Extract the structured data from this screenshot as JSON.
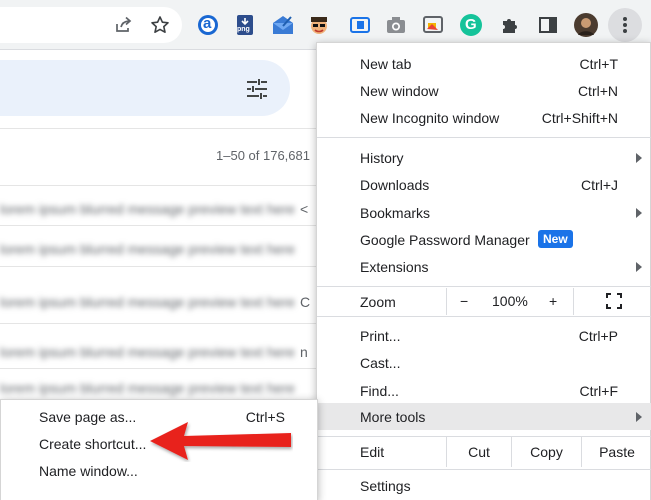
{
  "toolbar": {
    "icons": [
      "share-icon",
      "star-icon",
      "extension-a-icon",
      "extension-png-icon",
      "extension-mail-icon",
      "extension-avatar-icon",
      "extension-sidebar-icon",
      "camera-icon",
      "extension-image-icon",
      "grammarly-icon",
      "puzzle-icon",
      "side-panel-icon",
      "profile-avatar",
      "kebab-menu-icon"
    ],
    "grammarly_letter": "G",
    "a_letter": "a",
    "png_label": "png"
  },
  "gmail": {
    "count": "1–50 of 176,681",
    "rows": [
      {
        "text": "lorem ipsum blurred message preview text here",
        "cut": "<"
      },
      {
        "text": "lorem ipsum blurred message preview text here",
        "cut": ""
      },
      {
        "text": "lorem ipsum blurred message preview text here",
        "cut": "C"
      },
      {
        "text": "lorem ipsum blurred message preview text here",
        "cut": "n"
      },
      {
        "text": "lorem ipsum blurred message preview text here",
        "cut": ""
      }
    ]
  },
  "menu": {
    "new_tab": {
      "label": "New tab",
      "shortcut": "Ctrl+T"
    },
    "new_window": {
      "label": "New window",
      "shortcut": "Ctrl+N"
    },
    "new_incognito": {
      "label": "New Incognito window",
      "shortcut": "Ctrl+Shift+N"
    },
    "history": {
      "label": "History"
    },
    "downloads": {
      "label": "Downloads",
      "shortcut": "Ctrl+J"
    },
    "bookmarks": {
      "label": "Bookmarks"
    },
    "password_manager": {
      "label": "Google Password Manager",
      "badge": "New"
    },
    "extensions": {
      "label": "Extensions"
    },
    "zoom": {
      "label": "Zoom",
      "minus": "−",
      "value": "100%",
      "plus": "+"
    },
    "print": {
      "label": "Print...",
      "shortcut": "Ctrl+P"
    },
    "cast": {
      "label": "Cast..."
    },
    "find": {
      "label": "Find...",
      "shortcut": "Ctrl+F"
    },
    "more_tools": {
      "label": "More tools"
    },
    "edit": {
      "label": "Edit",
      "cut": "Cut",
      "copy": "Copy",
      "paste": "Paste"
    },
    "settings": {
      "label": "Settings"
    }
  },
  "submenu": {
    "save_page": {
      "label": "Save page as...",
      "shortcut": "Ctrl+S"
    },
    "create_shortcut": {
      "label": "Create shortcut..."
    },
    "name_window": {
      "label": "Name window..."
    }
  },
  "colors": {
    "accent_blue": "#1a73e8",
    "arrow_red": "#e8231f",
    "grammarly_green": "#15c39a",
    "highlight": "#e8e8e9"
  }
}
